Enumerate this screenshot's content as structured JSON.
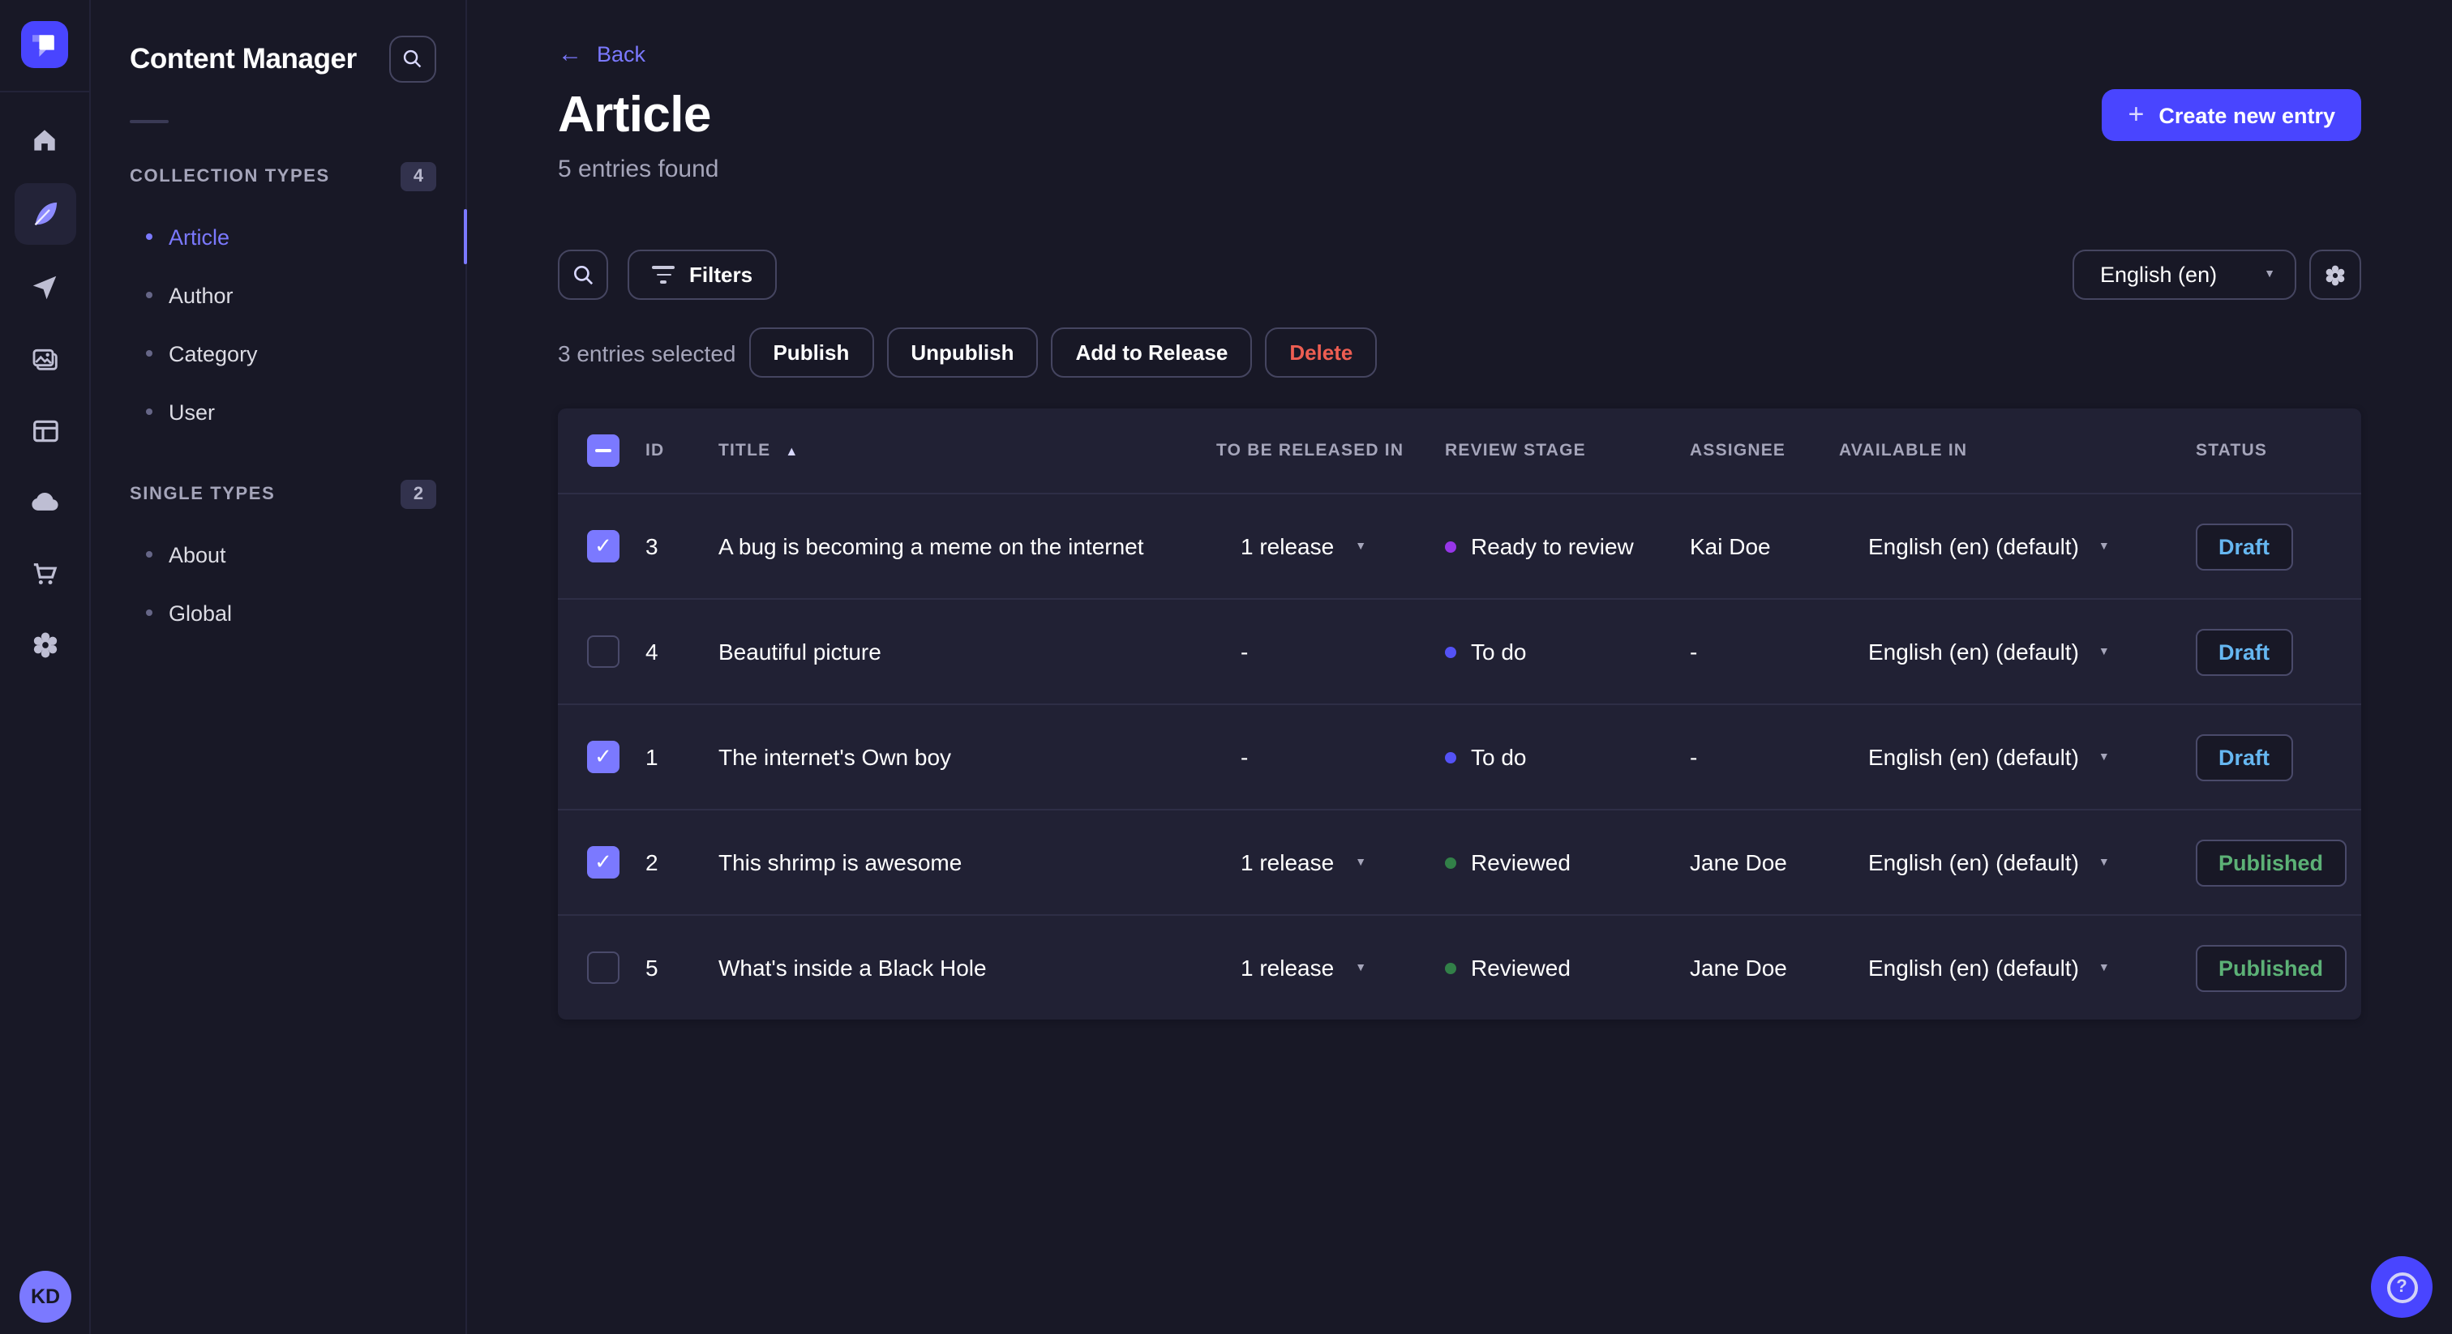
{
  "colors": {
    "brand": "#4945ff",
    "accent": "#7b79ff",
    "danger": "#ee5e52",
    "success_text": "#5cb176",
    "draft_text": "#66b7f1",
    "dot_todo": "#5452f6",
    "dot_ready": "#9736e8",
    "dot_reviewed": "#328048",
    "page_bg": "#181826",
    "card_bg": "#212134"
  },
  "rail": {
    "icons": [
      "strapi-logo",
      "home-icon",
      "feather-icon",
      "send-icon",
      "media-library-icon",
      "content-type-builder-icon",
      "cloud-icon",
      "marketplace-cart-icon",
      "settings-gear-icon"
    ],
    "active_icon": "feather-icon"
  },
  "user": {
    "initials": "KD"
  },
  "panel": {
    "title": "Content Manager",
    "sections": [
      {
        "label": "COLLECTION TYPES",
        "count": "4",
        "items": [
          {
            "label": "Article",
            "active": true
          },
          {
            "label": "Author"
          },
          {
            "label": "Category"
          },
          {
            "label": "User"
          }
        ]
      },
      {
        "label": "SINGLE TYPES",
        "count": "2",
        "items": [
          {
            "label": "About"
          },
          {
            "label": "Global"
          }
        ]
      }
    ]
  },
  "header": {
    "back_label": "Back",
    "title": "Article",
    "subtitle": "5 entries found",
    "create_button": "Create new entry"
  },
  "toolbar": {
    "filters_label": "Filters",
    "locale_select": "English (en)"
  },
  "selection": {
    "text": "3 entries selected",
    "actions": [
      "Publish",
      "Unpublish",
      "Add to Release",
      "Delete"
    ]
  },
  "table": {
    "columns": [
      "ID",
      "TITLE",
      "TO BE RELEASED IN",
      "REVIEW STAGE",
      "ASSIGNEE",
      "AVAILABLE IN",
      "STATUS"
    ],
    "sorted_column": "TITLE",
    "rows": [
      {
        "checked": true,
        "id": "3",
        "title": "A bug is becoming a meme on the internet",
        "release": "1 release",
        "release_caret": true,
        "review": "Ready to review",
        "review_color": "#9736e8",
        "assignee": "Kai Doe",
        "available": "English (en) (default)",
        "status": "Draft",
        "status_color": "#66b7f1"
      },
      {
        "checked": false,
        "id": "4",
        "title": "Beautiful picture",
        "release": "-",
        "release_caret": false,
        "review": "To do",
        "review_color": "#5452f6",
        "assignee": "-",
        "available": "English (en) (default)",
        "status": "Draft",
        "status_color": "#66b7f1"
      },
      {
        "checked": true,
        "id": "1",
        "title": "The internet's Own boy",
        "release": "-",
        "release_caret": false,
        "review": "To do",
        "review_color": "#5452f6",
        "assignee": "-",
        "available": "English (en) (default)",
        "status": "Draft",
        "status_color": "#66b7f1"
      },
      {
        "checked": true,
        "id": "2",
        "title": "This shrimp is awesome",
        "release": "1 release",
        "release_caret": true,
        "review": "Reviewed",
        "review_color": "#328048",
        "assignee": "Jane Doe",
        "available": "English (en) (default)",
        "status": "Published",
        "status_color": "#5cb176"
      },
      {
        "checked": false,
        "id": "5",
        "title": "What's inside a Black Hole",
        "release": "1 release",
        "release_caret": true,
        "review": "Reviewed",
        "review_color": "#328048",
        "assignee": "Jane Doe",
        "available": "English (en) (default)",
        "status": "Published",
        "status_color": "#5cb176"
      }
    ]
  },
  "help": {
    "label": "?"
  }
}
